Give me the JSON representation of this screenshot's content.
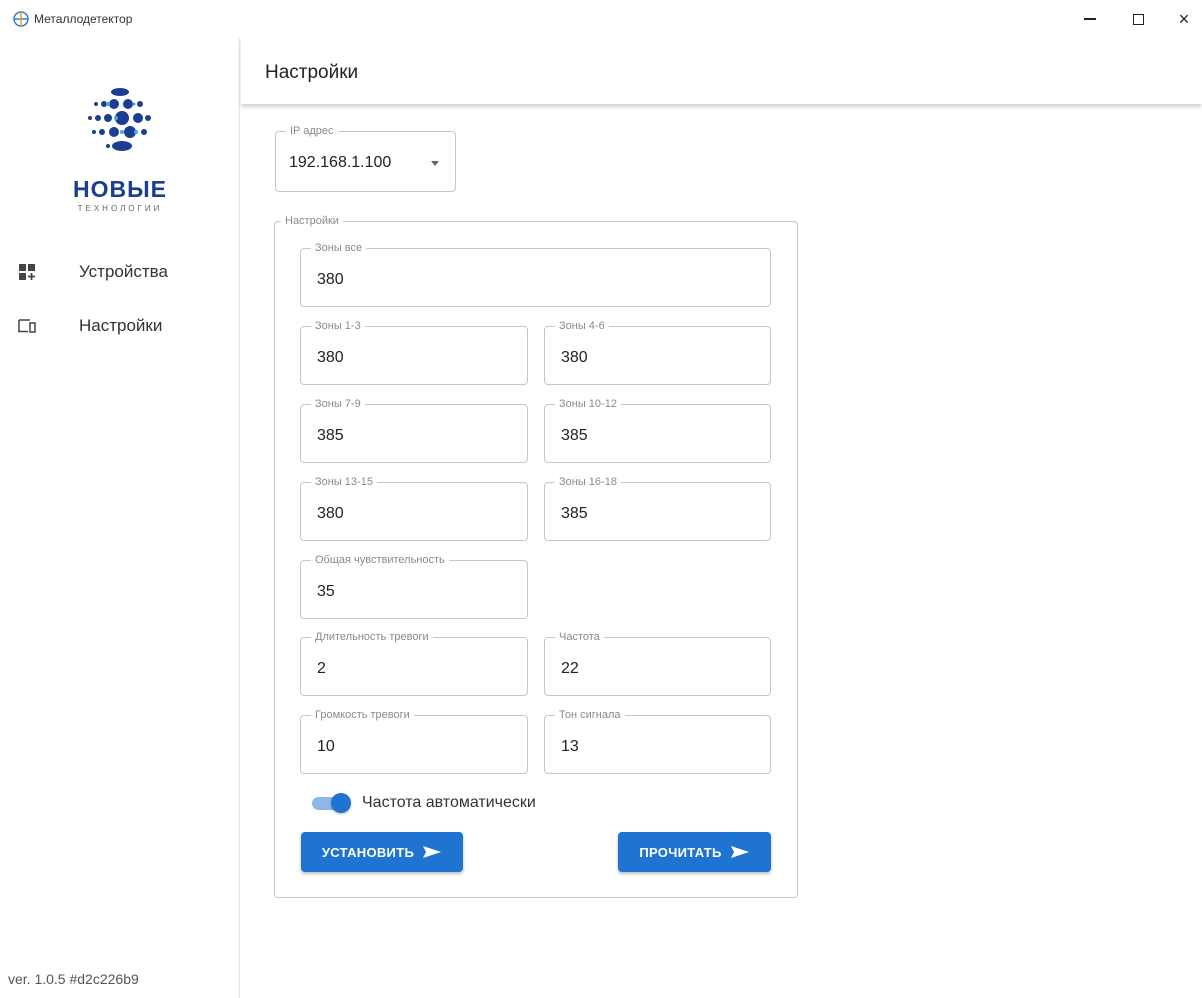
{
  "window": {
    "title": "Металлодетектор",
    "close_glyph": "×"
  },
  "sidebar": {
    "logo": {
      "text": "НОВЫЕ",
      "subtext": "ТЕХНОЛОГИИ"
    },
    "items": [
      {
        "label": "Устройства",
        "icon": "devices-grid-icon"
      },
      {
        "label": "Настройки",
        "icon": "monitor-settings-icon"
      }
    ],
    "version": "ver. 1.0.5 #d2c226b9"
  },
  "header": {
    "title": "Настройки"
  },
  "ip": {
    "label": "IP адрес",
    "value": "192.168.1.100"
  },
  "settings": {
    "group_label": "Настройки",
    "zones_all": {
      "label": "Зоны все",
      "value": "380"
    },
    "zones_1_3": {
      "label": "Зоны 1-3",
      "value": "380"
    },
    "zones_4_6": {
      "label": "Зоны 4-6",
      "value": "380"
    },
    "zones_7_9": {
      "label": "Зоны 7-9",
      "value": "385"
    },
    "zones_10_12": {
      "label": "Зоны 10-12",
      "value": "385"
    },
    "zones_13_15": {
      "label": "Зоны 13-15",
      "value": "380"
    },
    "zones_16_18": {
      "label": "Зоны 16-18",
      "value": "385"
    },
    "sensitivity": {
      "label": "Общая чувствительность",
      "value": "35"
    },
    "alarm_duration": {
      "label": "Длительность тревоги",
      "value": "2"
    },
    "frequency": {
      "label": "Частота",
      "value": "22"
    },
    "alarm_volume": {
      "label": "Громкость тревоги",
      "value": "10"
    },
    "signal_tone": {
      "label": "Тон сигнала",
      "value": "13"
    },
    "auto_frequency": {
      "label": "Частота автоматически",
      "enabled": true
    }
  },
  "buttons": {
    "set": "УСТАНОВИТЬ",
    "read": "ПРОЧИТАТЬ"
  },
  "colors": {
    "primary": "#1f74d1",
    "toggle_track": "#8fb6e6",
    "logo_blue": "#1b3d92"
  }
}
